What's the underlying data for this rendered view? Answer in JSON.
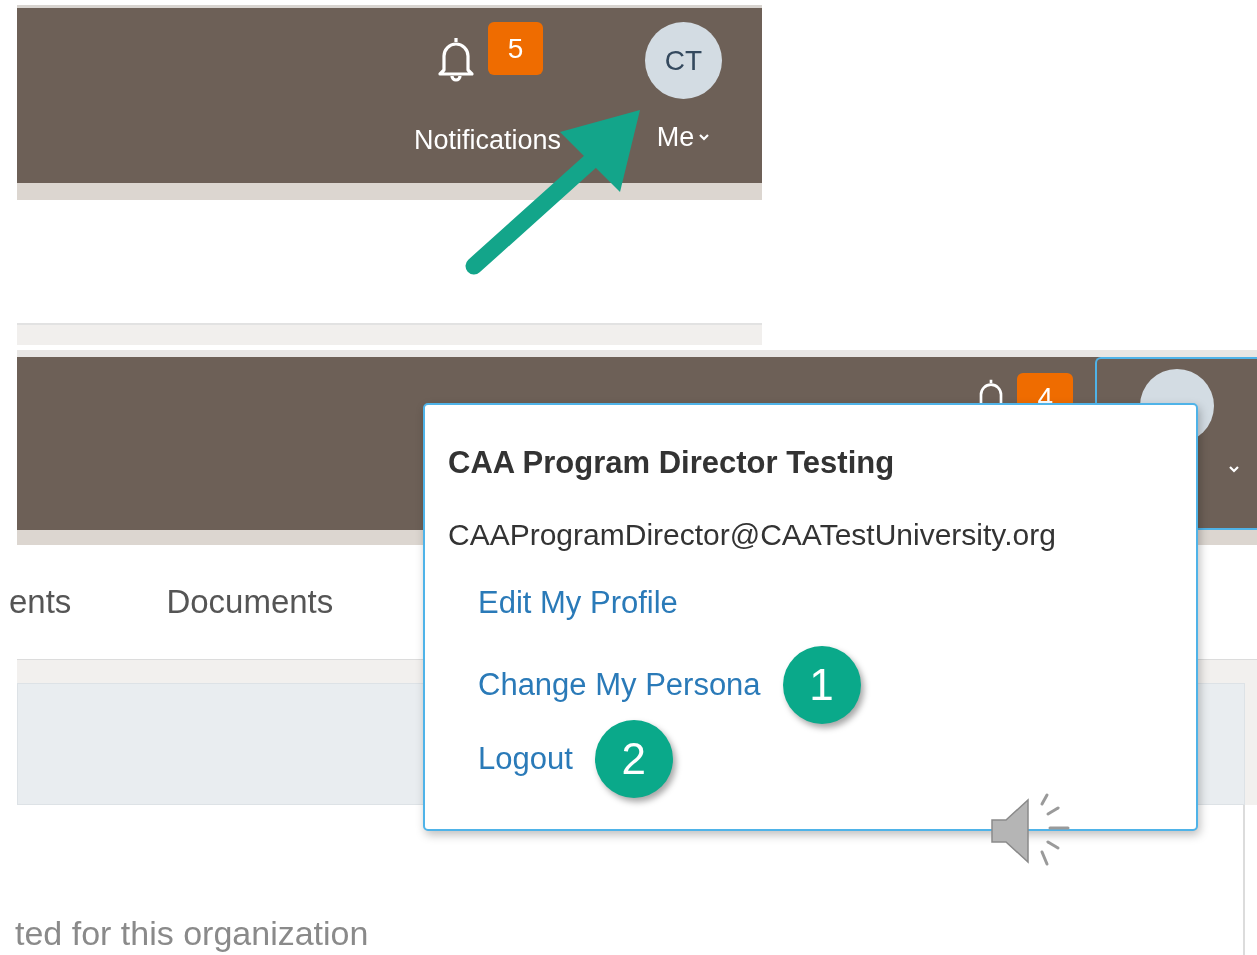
{
  "top_screenshot": {
    "notifications": {
      "count": "5",
      "label": "Notifications"
    },
    "account": {
      "initials": "CT",
      "label": "Me"
    }
  },
  "bottom_screenshot": {
    "notifications": {
      "count": "4"
    },
    "tabs": [
      {
        "label": "ents"
      },
      {
        "label": "Documents"
      }
    ],
    "body_text": "ted for this organization",
    "menu": {
      "name": "CAA Program Director Testing",
      "email": "CAAProgramDirector@CAATestUniversity.org",
      "items": [
        {
          "label": "Edit My Profile"
        },
        {
          "label": "Change My Persona",
          "step": "1"
        },
        {
          "label": "Logout",
          "step": "2"
        }
      ]
    }
  }
}
